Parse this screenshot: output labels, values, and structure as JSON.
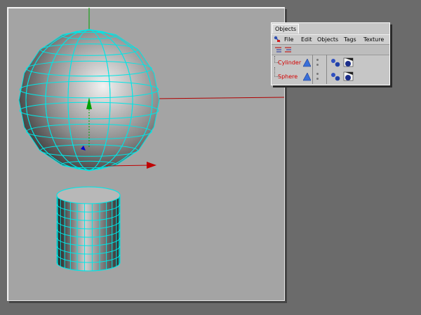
{
  "objects_panel": {
    "tab_label": "Objects",
    "menu": [
      "File",
      "Edit",
      "Objects",
      "Tags",
      "Texture"
    ],
    "objects": [
      {
        "name": "Cylinder",
        "icon": "cone-object-icon",
        "tags": [
          "phong-tag-icon",
          "texture-tag-icon"
        ]
      },
      {
        "name": "Sphere",
        "icon": "cone-object-icon",
        "tags": [
          "phong-tag-icon",
          "texture-tag-icon"
        ]
      }
    ]
  },
  "colors": {
    "wireframe": "#00e6e6",
    "axis_x": "#c00000",
    "axis_y": "#00a000",
    "axis_z": "#0000d0",
    "object_name": "#d40000",
    "viewport_bg": "#a4a4a4",
    "desktop_bg": "#6b6b6b"
  }
}
